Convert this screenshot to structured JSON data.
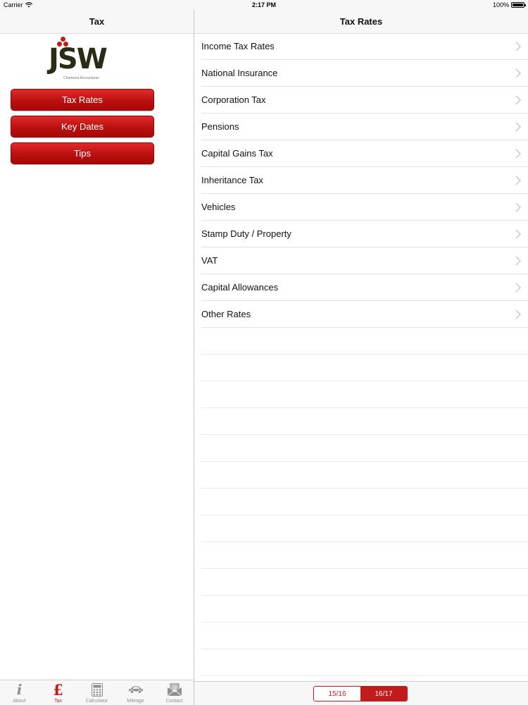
{
  "status_bar": {
    "carrier": "Carrier",
    "time": "2:17 PM",
    "battery": "100%"
  },
  "master": {
    "title": "Tax",
    "logo": {
      "word": "JSW",
      "tagline": "Chartered Accountants"
    },
    "menu": [
      {
        "label": "Tax Rates"
      },
      {
        "label": "Key Dates"
      },
      {
        "label": "Tips"
      }
    ]
  },
  "tab_bar": {
    "tabs": [
      {
        "label": "About",
        "icon": "info-icon",
        "active": false
      },
      {
        "label": "Tax",
        "icon": "pound-icon",
        "active": true
      },
      {
        "label": "Calculator",
        "icon": "calculator-icon",
        "active": false
      },
      {
        "label": "Mileage",
        "icon": "car-icon",
        "active": false
      },
      {
        "label": "Contact",
        "icon": "envelope-icon",
        "active": false
      }
    ]
  },
  "detail": {
    "title": "Tax Rates",
    "rows": [
      {
        "label": "Income Tax Rates"
      },
      {
        "label": "National Insurance"
      },
      {
        "label": "Corporation Tax"
      },
      {
        "label": "Pensions"
      },
      {
        "label": "Capital Gains Tax"
      },
      {
        "label": "Inheritance Tax"
      },
      {
        "label": "Vehicles"
      },
      {
        "label": "Stamp Duty / Property"
      },
      {
        "label": "VAT"
      },
      {
        "label": "Capital Allowances"
      },
      {
        "label": "Other Rates"
      }
    ],
    "year_selector": {
      "options": [
        "15/16",
        "16/17"
      ],
      "selected": "16/17"
    }
  },
  "colors": {
    "accent": "#c11b1b",
    "logo_text": "#2b2b16",
    "bar_bg": "#f7f7f7"
  }
}
